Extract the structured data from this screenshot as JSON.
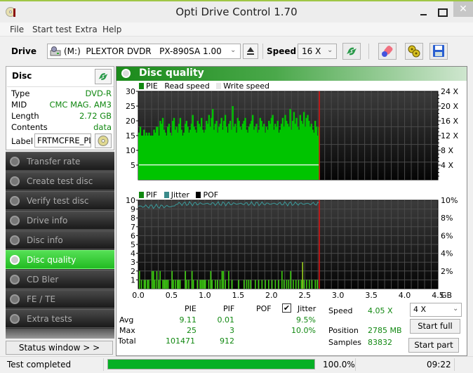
{
  "window": {
    "title": "Opti Drive Control 1.70",
    "close_glyph": "✕"
  },
  "menu": [
    "File",
    "Start test",
    "Extra",
    "Help"
  ],
  "toolbar": {
    "drive_label": "Drive",
    "drive_value": "(M:)  PLEXTOR DVDR   PX-890SA 1.00",
    "speed_label": "Speed",
    "speed_value": "16 X",
    "chevron": "⌄"
  },
  "disc": {
    "title": "Disc",
    "rows": [
      {
        "key": "Type",
        "value": "DVD-R"
      },
      {
        "key": "MID",
        "value": "CMC MAG. AM3"
      },
      {
        "key": "Length",
        "value": "2.72 GB"
      },
      {
        "key": "Contents",
        "value": "data"
      }
    ],
    "label_key": "Label",
    "label_value": "FRTMCFRE_PL"
  },
  "nav": [
    {
      "label": "Transfer rate",
      "active": false
    },
    {
      "label": "Create test disc",
      "active": false
    },
    {
      "label": "Verify test disc",
      "active": false
    },
    {
      "label": "Drive info",
      "active": false
    },
    {
      "label": "Disc info",
      "active": false
    },
    {
      "label": "Disc quality",
      "active": true
    },
    {
      "label": "CD Bler",
      "active": false
    },
    {
      "label": "FE / TE",
      "active": false
    },
    {
      "label": "Extra tests",
      "active": false
    }
  ],
  "status_window_label": "Status window > >",
  "main": {
    "title": "Disc quality",
    "legend_top": [
      {
        "label": "PIE",
        "color": "#118811"
      },
      {
        "label": "Read speed",
        "color": null
      },
      {
        "label": "Write speed",
        "color": "#e8e8e8"
      }
    ],
    "legend_bottom": [
      {
        "label": "PIF",
        "color": "#118811"
      },
      {
        "label": "Jitter",
        "color": "#3a8a8a"
      },
      {
        "label": "POF",
        "color": "#000000"
      }
    ]
  },
  "chart_data": [
    {
      "type": "bar",
      "title": "PIE",
      "xlabel": "GB",
      "x_ticks": [
        "0.0",
        "0.5",
        "1.0",
        "1.5",
        "2.0",
        "2.5",
        "3.0",
        "3.5",
        "4.0",
        "4.5"
      ],
      "xlim": [
        0,
        4.5
      ],
      "y_ticks": [
        "5",
        "10",
        "15",
        "20",
        "25",
        "30"
      ],
      "ylim": [
        0,
        30
      ],
      "y2_ticks": [
        "4 X",
        "8 X",
        "12 X",
        "16 X",
        "20 X",
        "24 X"
      ],
      "y2lim": [
        0,
        24
      ],
      "disc_end_gb": 2.72,
      "pie_baseline": 15,
      "pie_profile": [
        16,
        18,
        15,
        13,
        17,
        12,
        16,
        11,
        16,
        13,
        14,
        15,
        17,
        16,
        18,
        18,
        15,
        20,
        19,
        21,
        17,
        16,
        14,
        18,
        19,
        16,
        15,
        20,
        21,
        17,
        18,
        16,
        19,
        21,
        17,
        15,
        16,
        19,
        20,
        18,
        16,
        17,
        19,
        22,
        18,
        17,
        16,
        20,
        19,
        18,
        21,
        17,
        16,
        17,
        20,
        19,
        22,
        18,
        21,
        24,
        17,
        19,
        20,
        16,
        18,
        19,
        21,
        17,
        20,
        22,
        18,
        16,
        19,
        20,
        17,
        25,
        18,
        19,
        16,
        21,
        20,
        18,
        17,
        19,
        20,
        21,
        17,
        16,
        18,
        19,
        20,
        22,
        17,
        18,
        19,
        16,
        17,
        21,
        20,
        18,
        19,
        16,
        18,
        17,
        20,
        19,
        21,
        22,
        17,
        19,
        18,
        20,
        16,
        17,
        19,
        21,
        18,
        22,
        20,
        19,
        18,
        24,
        17,
        20,
        23,
        19,
        21,
        18,
        17,
        22,
        20,
        19,
        23,
        18,
        21,
        22,
        20,
        18,
        19,
        17,
        16,
        20,
        18,
        15,
        18
      ],
      "read_speed_x": 4.05
    },
    {
      "type": "bar",
      "title": "PIF / Jitter",
      "xlabel": "GB",
      "x_ticks": [
        "0.0",
        "0.5",
        "1.0",
        "1.5",
        "2.0",
        "2.5",
        "3.0",
        "3.5",
        "4.0",
        "4.5"
      ],
      "xlim": [
        0,
        4.5
      ],
      "y_ticks": [
        "1",
        "2",
        "3",
        "4",
        "5",
        "6",
        "7",
        "8",
        "9",
        "10"
      ],
      "ylim": [
        0,
        10
      ],
      "y2_ticks": [
        "2%",
        "4%",
        "6%",
        "8%",
        "10%"
      ],
      "y2lim": [
        0,
        10
      ],
      "disc_end_gb": 2.72,
      "pif_points": [
        [
          0.01,
          2
        ],
        [
          0.04,
          1
        ],
        [
          0.08,
          1
        ],
        [
          0.1,
          1
        ],
        [
          0.13,
          1
        ],
        [
          0.15,
          1
        ],
        [
          0.2,
          2
        ],
        [
          0.22,
          2
        ],
        [
          0.24,
          1
        ],
        [
          0.27,
          2
        ],
        [
          0.3,
          1
        ],
        [
          0.32,
          2
        ],
        [
          0.36,
          1
        ],
        [
          0.38,
          1
        ],
        [
          0.4,
          1
        ],
        [
          0.42,
          1
        ],
        [
          0.44,
          1
        ],
        [
          0.5,
          2
        ],
        [
          0.52,
          1
        ],
        [
          0.55,
          1
        ],
        [
          0.58,
          1
        ],
        [
          0.6,
          1
        ],
        [
          0.62,
          1
        ],
        [
          0.7,
          2
        ],
        [
          0.72,
          1
        ],
        [
          0.75,
          1
        ],
        [
          0.8,
          2
        ],
        [
          0.82,
          1
        ],
        [
          0.88,
          1
        ],
        [
          0.92,
          1
        ],
        [
          0.94,
          1
        ],
        [
          0.96,
          1
        ],
        [
          0.98,
          1
        ],
        [
          1.0,
          1
        ],
        [
          1.05,
          1
        ],
        [
          1.08,
          2
        ],
        [
          1.1,
          1
        ],
        [
          1.15,
          1
        ],
        [
          1.18,
          1
        ],
        [
          1.22,
          1
        ],
        [
          1.25,
          2
        ],
        [
          1.27,
          2
        ],
        [
          1.3,
          1
        ],
        [
          1.35,
          2
        ],
        [
          1.4,
          1
        ],
        [
          1.5,
          1
        ],
        [
          1.58,
          1
        ],
        [
          1.62,
          1
        ],
        [
          1.65,
          1
        ],
        [
          1.68,
          1
        ],
        [
          1.75,
          1
        ],
        [
          1.8,
          1
        ],
        [
          1.85,
          1
        ],
        [
          1.9,
          1
        ],
        [
          1.95,
          1
        ],
        [
          2.0,
          1
        ],
        [
          2.05,
          1
        ],
        [
          2.1,
          1
        ],
        [
          2.15,
          2
        ],
        [
          2.18,
          1
        ],
        [
          2.22,
          1
        ],
        [
          2.25,
          1
        ],
        [
          2.28,
          2
        ],
        [
          2.32,
          1
        ],
        [
          2.36,
          1
        ],
        [
          2.4,
          1
        ],
        [
          2.44,
          1
        ],
        [
          2.46,
          3
        ],
        [
          2.48,
          1
        ],
        [
          2.52,
          1
        ],
        [
          2.56,
          1
        ],
        [
          2.6,
          1
        ],
        [
          2.65,
          1
        ],
        [
          2.68,
          1
        ]
      ],
      "jitter_avg_pct": 9.5,
      "jitter_max_pct": 10.0
    }
  ],
  "stats": {
    "headers": [
      "PIE",
      "PIF",
      "POF",
      "Jitter"
    ],
    "rows": [
      {
        "label": "Avg",
        "pie": "9.11",
        "pif": "0.01",
        "pof": "",
        "jitter": "9.5%"
      },
      {
        "label": "Max",
        "pie": "25",
        "pif": "3",
        "pof": "",
        "jitter": "10.0%"
      },
      {
        "label": "Total",
        "pie": "101471",
        "pif": "912",
        "pof": "",
        "jitter": ""
      }
    ],
    "jitter_checked": true,
    "check_glyph": "✔",
    "speed_label": "Speed",
    "speed_value": "4.05 X",
    "position_label": "Position",
    "position_value": "2785 MB",
    "samples_label": "Samples",
    "samples_value": "83832",
    "test_speed_value": "4 X",
    "start_full_label": "Start full",
    "start_part_label": "Start part"
  },
  "statusbar": {
    "text": "Test completed",
    "progress_pct": 100.0,
    "progress_text": "100.0%",
    "clock": "09:22"
  }
}
